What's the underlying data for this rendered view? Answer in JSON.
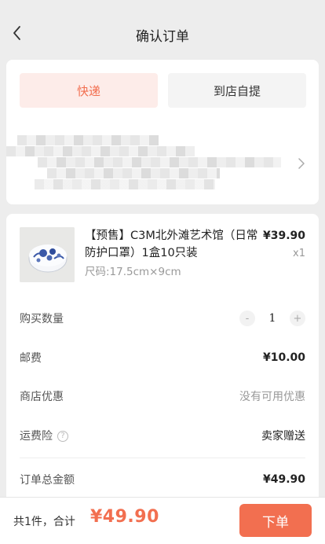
{
  "header": {
    "title": "确认订单",
    "back_icon": "chevron-left-icon"
  },
  "delivery": {
    "tabs": [
      {
        "label": "快递",
        "active": true
      },
      {
        "label": "到店自提",
        "active": false
      }
    ],
    "address_icon": "chevron-right-icon"
  },
  "product": {
    "title": "【预售】C3M北外滩艺术馆（日常防护口罩）1盒10只装",
    "price": "¥39.90",
    "quantity": "x1",
    "spec": "尺码:17.5cm×9cm"
  },
  "rows": {
    "quantity_label": "购买数量",
    "quantity_value": "1",
    "minus": "-",
    "plus": "+",
    "shipping_label": "邮费",
    "shipping_value": "¥10.00",
    "discount_label": "商店优惠",
    "discount_value": "没有可用优惠",
    "insurance_label": "运费险",
    "insurance_help": "?",
    "insurance_value": "卖家赠送",
    "total_label": "订单总金额",
    "total_value": "¥49.90"
  },
  "footer": {
    "count_text": "共1件，合计",
    "total": "¥49.90",
    "submit_label": "下单"
  },
  "colors": {
    "accent": "#f26f50",
    "accent_bg": "#fdece9",
    "page_bg": "#ededed"
  }
}
